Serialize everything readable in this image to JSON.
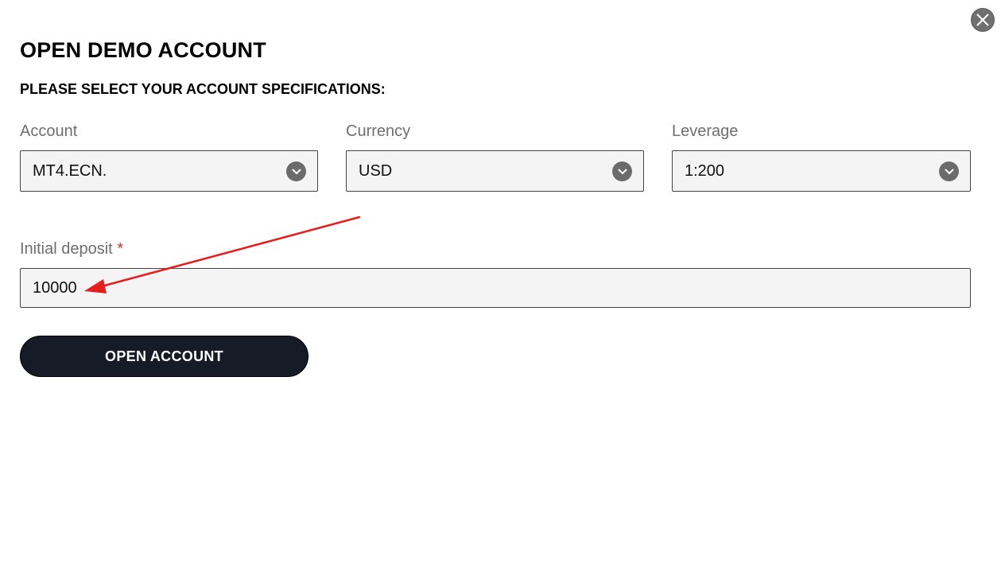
{
  "modal": {
    "title": "OPEN DEMO ACCOUNT",
    "subtitle": "PLEASE SELECT YOUR ACCOUNT SPECIFICATIONS:"
  },
  "fields": {
    "account": {
      "label": "Account",
      "value": "MT4.ECN."
    },
    "currency": {
      "label": "Currency",
      "value": "USD"
    },
    "leverage": {
      "label": "Leverage",
      "value": "1:200"
    },
    "deposit": {
      "label": "Initial deposit",
      "required_mark": "*",
      "value": "10000"
    }
  },
  "actions": {
    "open_account_label": "OPEN ACCOUNT"
  },
  "icons": {
    "close": "close-icon",
    "dropdown": "chevron-down-icon"
  },
  "colors": {
    "button_bg": "#161c27",
    "field_bg": "#f4f4f4",
    "label": "#6e6e6e",
    "annotation_arrow": "#e41d1d",
    "required": "#c0392b"
  }
}
